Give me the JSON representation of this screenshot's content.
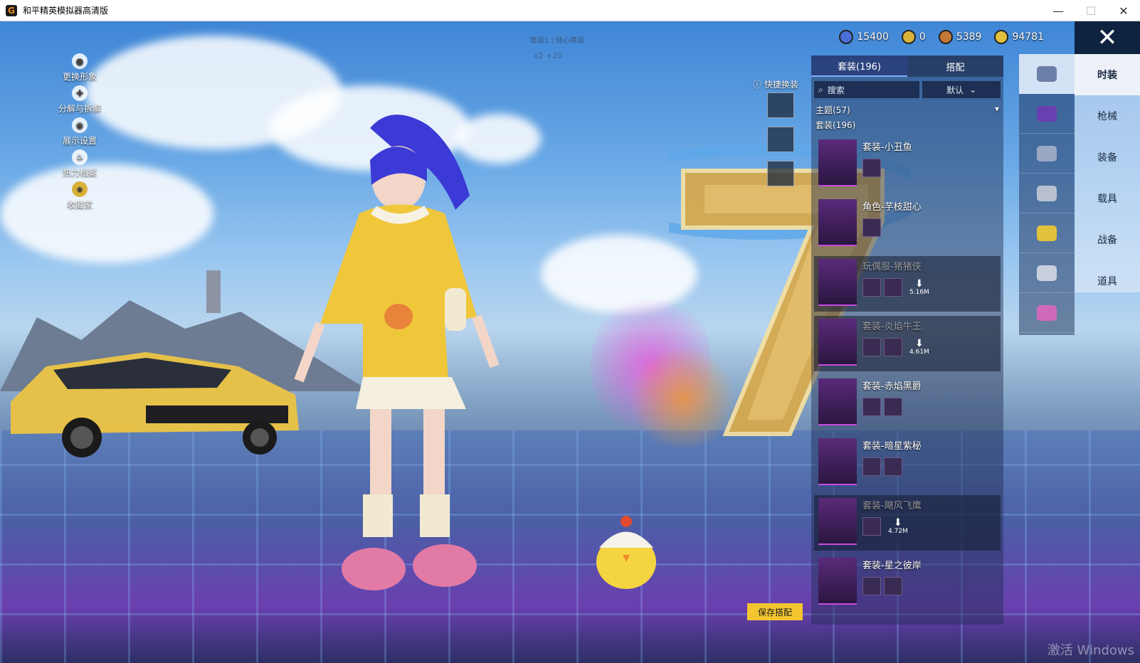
{
  "window": {
    "title": "和平精英模拟器高清版",
    "app_icon": "G"
  },
  "top_hint": {
    "line1": "套装1 | 随心换装",
    "line2": "x2   +20"
  },
  "left_menu": [
    {
      "label": "更换形象",
      "icon": "avatar-icon"
    },
    {
      "label": "分解与拆解",
      "icon": "puzzle-icon"
    },
    {
      "label": "展示设置",
      "icon": "eye-icon"
    },
    {
      "label": "热力档案",
      "icon": "flame-icon"
    },
    {
      "label": "收藏家",
      "icon": "collector-badge-icon"
    }
  ],
  "currency": [
    {
      "value": "15400",
      "color": "#4a6fd6"
    },
    {
      "value": "0",
      "color": "#d8b23a"
    },
    {
      "value": "5389",
      "color": "#c47a36"
    },
    {
      "value": "94781",
      "color": "#e2c13c"
    }
  ],
  "quick_change": {
    "label": "快捷换装"
  },
  "panel": {
    "tabs": [
      {
        "label": "套装(196)",
        "active": true
      },
      {
        "label": "搭配",
        "active": false
      }
    ],
    "search_placeholder": "搜索",
    "sort_value": "默认",
    "group_theme": "主题(57)",
    "group_suits": "套装(196)",
    "outfits": [
      {
        "name": "套装-小丑鱼",
        "dim": false,
        "download": ""
      },
      {
        "name": "角色-芋枝甜心",
        "dim": false,
        "download": ""
      },
      {
        "name": "玩偶服-猪猪侠",
        "dim": true,
        "download": "5.16M"
      },
      {
        "name": "套装-炎焰牛王",
        "dim": true,
        "download": "4.61M"
      },
      {
        "name": "套装-赤焰黑爵",
        "dim": false,
        "download": ""
      },
      {
        "name": "套装-暗星紫秘",
        "dim": false,
        "download": ""
      },
      {
        "name": "套装-飓风飞鹰",
        "dim": true,
        "download": "4.72M"
      },
      {
        "name": "套装-星之彼岸",
        "dim": false,
        "download": ""
      }
    ]
  },
  "categories": [
    {
      "label": "时装",
      "active": true
    },
    {
      "label": "枪械",
      "active": false
    },
    {
      "label": "装备",
      "active": false
    },
    {
      "label": "载具",
      "active": false
    },
    {
      "label": "战备",
      "active": false
    },
    {
      "label": "道具",
      "active": false
    }
  ],
  "icon_tabs": [
    "hat-icon",
    "outfit-icon",
    "glasses-icon",
    "mask-icon",
    "jacket-icon",
    "hanger-icon",
    "shoes-icon"
  ],
  "save_button": "保存搭配",
  "watermark": "激活 Windows"
}
